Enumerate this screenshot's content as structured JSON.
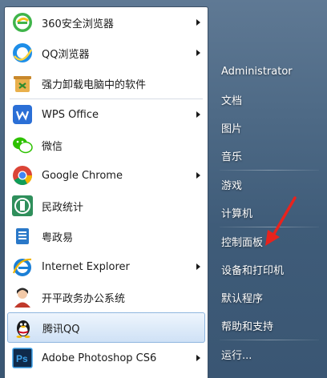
{
  "left_menu": {
    "group1": [
      {
        "label": "360安全浏览器",
        "icon": "360-browser-icon",
        "has_submenu": true
      },
      {
        "label": "QQ浏览器",
        "icon": "qq-browser-icon",
        "has_submenu": true
      },
      {
        "label": "强力卸载电脑中的软件",
        "icon": "uninstaller-icon",
        "has_submenu": false
      }
    ],
    "group2": [
      {
        "label": "WPS Office",
        "icon": "wps-icon",
        "has_submenu": true
      },
      {
        "label": "微信",
        "icon": "wechat-icon",
        "has_submenu": false
      },
      {
        "label": "Google Chrome",
        "icon": "chrome-icon",
        "has_submenu": true
      },
      {
        "label": "民政统计",
        "icon": "civil-statistics-icon",
        "has_submenu": false
      },
      {
        "label": "粤政易",
        "icon": "yuezhengyi-icon",
        "has_submenu": false
      },
      {
        "label": "Internet Explorer",
        "icon": "internet-explorer-icon",
        "has_submenu": true
      },
      {
        "label": "开平政务办公系统",
        "icon": "office-system-icon",
        "has_submenu": false
      },
      {
        "label": "腾讯QQ",
        "icon": "qq-penguin-icon",
        "has_submenu": false,
        "selected": true
      },
      {
        "label": "Adobe Photoshop CS6",
        "icon": "photoshop-icon",
        "has_submenu": true
      }
    ]
  },
  "right_menu": {
    "user": "Administrator",
    "items_a": [
      "文档",
      "图片",
      "音乐"
    ],
    "items_b": [
      "游戏",
      "计算机"
    ],
    "items_c": [
      "控制面板",
      "设备和打印机",
      "默认程序",
      "帮助和支持"
    ],
    "items_d": [
      "运行..."
    ]
  },
  "colors": {
    "selection_border": "#8fb6df",
    "panel_dark": "#3f5c79",
    "annotation_arrow": "#e8231d"
  }
}
